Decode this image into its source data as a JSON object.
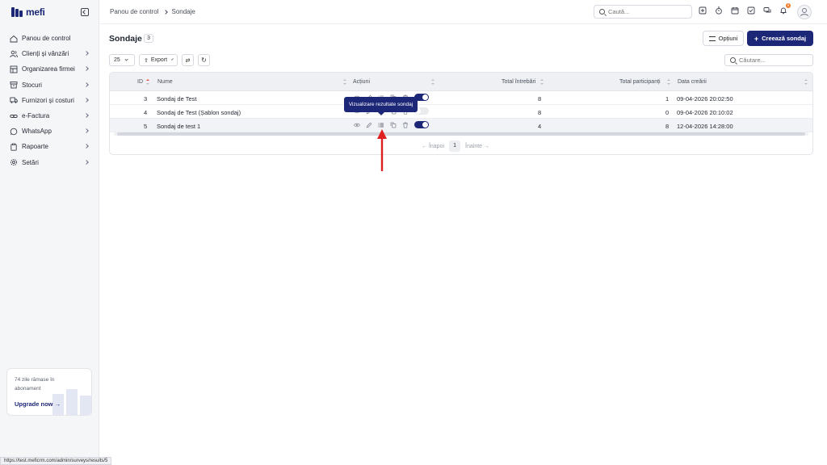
{
  "app": {
    "logo_text": "mefi"
  },
  "sidebar": {
    "items": [
      {
        "label": "Panou de control",
        "icon": "home-icon",
        "has_children": false
      },
      {
        "label": "Clienți și vânzări",
        "icon": "users-icon",
        "has_children": true
      },
      {
        "label": "Organizarea firmei",
        "icon": "org-chart-icon",
        "has_children": true
      },
      {
        "label": "Stocuri",
        "icon": "box-icon",
        "has_children": true
      },
      {
        "label": "Furnizori și costuri",
        "icon": "truck-icon",
        "has_children": true
      },
      {
        "label": "e-Factura",
        "icon": "link-icon",
        "has_children": true
      },
      {
        "label": "WhatsApp",
        "icon": "chat-icon",
        "has_children": true
      },
      {
        "label": "Rapoarte",
        "icon": "clipboard-icon",
        "has_children": true
      },
      {
        "label": "Setări",
        "icon": "gear-icon",
        "has_children": true
      }
    ],
    "upgrade": {
      "text": "74 zile rămase în abonament",
      "link": "Upgrade now"
    }
  },
  "header": {
    "breadcrumb": [
      "Panou de control",
      "Sondaje"
    ],
    "search_placeholder": "Caută...",
    "notification_count": "0"
  },
  "page": {
    "title": "Sondaje",
    "count": "3",
    "options_label": "Opțiuni",
    "create_label": "Creează sondaj",
    "page_size": "25",
    "export_label": "Export",
    "table_search_placeholder": "Căutare..."
  },
  "table": {
    "columns": [
      "ID",
      "Nume",
      "Acțiuni",
      "Total întrebări",
      "Total participanți",
      "Data creării"
    ],
    "rows": [
      {
        "id": "3",
        "name": "Sondaj de Test",
        "questions": "8",
        "participants": "1",
        "created": "09-04-2026 20:02:50",
        "active": true
      },
      {
        "id": "4",
        "name": "Sondaj de Test (Șablon sondaj)",
        "questions": "8",
        "participants": "0",
        "created": "09-04-2026 20:10:02",
        "active": false
      },
      {
        "id": "5",
        "name": "Sondaj de test 1",
        "questions": "4",
        "participants": "8",
        "created": "12-04-2026 14:28:00",
        "active": true
      }
    ]
  },
  "pagination": {
    "prev": "← Înapoi",
    "current": "1",
    "next": "Înainte →"
  },
  "tooltip": {
    "text": "Vizualizare rezultate sondaj"
  },
  "status_url": "https://test.meficrm.com/admin/surveys/results/5",
  "colors": {
    "primary": "#1d2777",
    "annotation": "#e02020",
    "sort_active": "#e04b3a",
    "badge": "#f07b2c"
  }
}
